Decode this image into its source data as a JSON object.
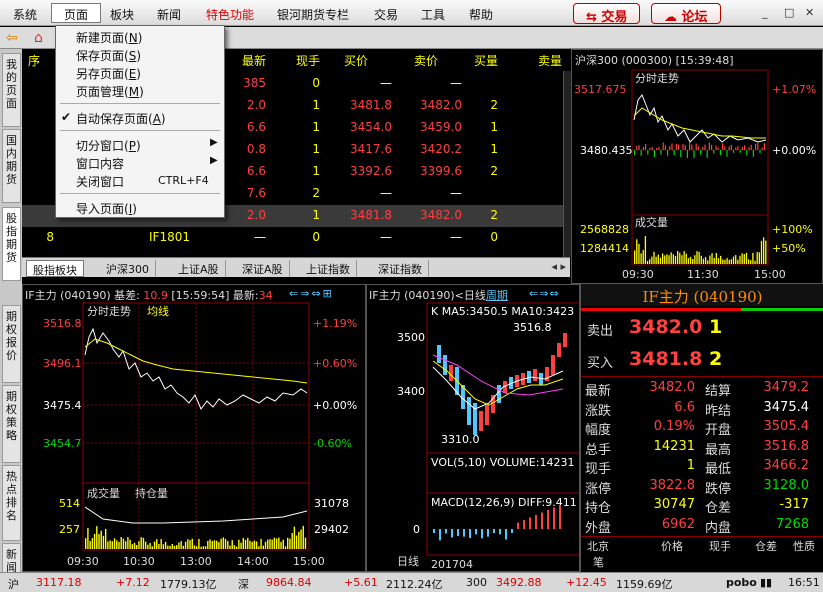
{
  "menubar": {
    "items": [
      "系统",
      "页面",
      "板块",
      "新闻",
      "特色功能",
      "银河期货专栏",
      "交易",
      "工具",
      "帮助"
    ],
    "trade_label": "交易",
    "forum_label": "论坛"
  },
  "page_menu": {
    "items": [
      "新建页面",
      "保存页面",
      "另存页面",
      "页面管理",
      "自动保存页面",
      "切分窗口",
      "窗口内容",
      "关闭窗口",
      "导入页面"
    ],
    "mnemonics": [
      "N",
      "S",
      "E",
      "M",
      "A",
      "P",
      "",
      "",
      "I"
    ],
    "close_shortcut": "CTRL+F4"
  },
  "left_tabs": [
    "我的页面",
    "国内期货",
    "股指期货",
    "期权报价",
    "期权策略",
    "热点排名",
    "新闻"
  ],
  "list": {
    "headers": [
      "序",
      "最新",
      "现手",
      "买价",
      "卖价",
      "买量",
      "卖量"
    ],
    "rows": [
      {
        "last": "385",
        "vol": "0",
        "bid": "—",
        "ask": "—",
        "bidq": "",
        "sel": false
      },
      {
        "last": "2.0",
        "vol": "1",
        "bid": "3481.8",
        "ask": "3482.0",
        "bidq": "2",
        "sel": false
      },
      {
        "last": "6.6",
        "vol": "1",
        "bid": "3454.0",
        "ask": "3459.0",
        "bidq": "1",
        "sel": false
      },
      {
        "last": "0.8",
        "vol": "1",
        "bid": "3417.6",
        "ask": "3420.2",
        "bidq": "1",
        "sel": false
      },
      {
        "last": "6.6",
        "vol": "1",
        "bid": "3392.6",
        "ask": "3399.6",
        "bidq": "2",
        "sel": false
      },
      {
        "last": "7.6",
        "vol": "2",
        "bid": "—",
        "ask": "—",
        "bidq": "",
        "sel": false
      },
      {
        "last": "2.0",
        "vol": "1",
        "bid": "3481.8",
        "ask": "3482.0",
        "bidq": "2",
        "sel": true
      },
      {
        "seq": "8",
        "name": "IF1801",
        "last": "—",
        "vol": "0",
        "bid": "—",
        "ask": "—",
        "bidq": "0",
        "sel": false
      }
    ]
  },
  "bottom_tabs": [
    "股指板块",
    "沪深300",
    "上证A股",
    "深证A股",
    "上证指数",
    "深证指数"
  ],
  "hs300": {
    "title": "沪深300 (000300)",
    "time": "[15:39:48]",
    "sub": "分时走势",
    "vol_label": "成交量",
    "y_hi": "3517.675",
    "y_mid": "3480.435",
    "pct_hi": "+1.07%",
    "pct_mid": "+0.00%",
    "vol_hi": "2568828",
    "vol_mid": "1284414",
    "vol_pct_hi": "+100%",
    "vol_pct_mid": "+50%",
    "x_ticks": [
      "09:30",
      "11:30",
      "15:00"
    ]
  },
  "ifmain": {
    "title": "IF主力 (040190)",
    "basis_label": "基差:",
    "basis": "10.9",
    "time": "[15:59:54]",
    "last_label": "最新:",
    "last_partial": "34",
    "sub": "分时走势",
    "avg": "均线",
    "y_ticks": [
      "3516.8",
      "3496.1",
      "3475.4",
      "3454.7"
    ],
    "pct_ticks": [
      "+1.19%",
      "+0.60%",
      "+0.00%",
      "-0.60%"
    ],
    "vol_label": "成交量",
    "oi_label": "持仓量",
    "vol_ticks": [
      "514",
      "257"
    ],
    "oi_ticks": [
      "31078",
      "29402"
    ],
    "x_ticks": [
      "09:30",
      "10:30",
      "13:00",
      "14:00",
      "15:00"
    ]
  },
  "kline": {
    "title": "IF主力 (040190)<日线",
    "period": "周期",
    "ma": "K   MA5:3450.5  MA10:3423",
    "hi_label": "3516.8",
    "lo_label": "3310.0",
    "y_ticks": [
      "3500",
      "3400"
    ],
    "vol_label": "VOL(5,10)  VOLUME:14231",
    "macd_label": "MACD(12,26,9)  DIFF:9.411",
    "macd_zero": "0",
    "period_btn": "日线",
    "date": "201704"
  },
  "quote": {
    "name": "IF主力 (040190)",
    "sell_label": "卖出",
    "sell_price": "3482.0",
    "sell_qty": "1",
    "buy_label": "买入",
    "buy_price": "3481.8",
    "buy_qty": "2",
    "rows": [
      [
        "最新",
        "3482.0",
        "red",
        "结算",
        "3479.2",
        "red"
      ],
      [
        "涨跌",
        "6.6",
        "red",
        "昨结",
        "3475.4",
        "wht"
      ],
      [
        "幅度",
        "0.19%",
        "red",
        "开盘",
        "3505.4",
        "red"
      ],
      [
        "总手",
        "14231",
        "yel",
        "最高",
        "3516.8",
        "red"
      ],
      [
        "现手",
        "1",
        "yel",
        "最低",
        "3466.2",
        "red"
      ],
      [
        "涨停",
        "3822.8",
        "red",
        "跌停",
        "3128.0",
        "grn"
      ],
      [
        "持仓",
        "30747",
        "yel",
        "仓差",
        "-317",
        "yel"
      ],
      [
        "外盘",
        "6962",
        "red",
        "内盘",
        "7268",
        "grn"
      ]
    ],
    "tick_headers": [
      "北京",
      "价格",
      "现手",
      "仓差",
      "性质"
    ],
    "tick_row": "笔"
  },
  "status": {
    "sh_label": "沪",
    "sh": "3117.18",
    "sh_chg": "+7.12",
    "sh_amt": "1779.13亿",
    "sz_label": "深",
    "sz": "9864.84",
    "sz_chg": "+5.61",
    "sz_amt": "2112.24亿",
    "hs_label": "300",
    "hs": "3492.88",
    "hs_chg": "+12.45",
    "hs_amt": "1159.69亿",
    "brand": "pobo",
    "clock": "16:51"
  }
}
